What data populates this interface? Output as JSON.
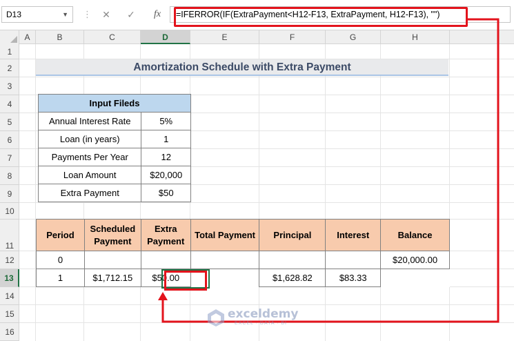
{
  "formula_bar": {
    "name_box": "D13",
    "cancel_icon": "✕",
    "enter_icon": "✓",
    "fx_label": "fx",
    "formula": "=IFERROR(IF(ExtraPayment<H12-F13, ExtraPayment, H12-F13), \"\")"
  },
  "columns": [
    "A",
    "B",
    "C",
    "D",
    "E",
    "F",
    "G",
    "H"
  ],
  "selected_column": "D",
  "rows": [
    "1",
    "2",
    "3",
    "4",
    "5",
    "6",
    "7",
    "8",
    "9",
    "10",
    "11",
    "12",
    "13",
    "14",
    "15",
    "16"
  ],
  "selected_row": "13",
  "title": "Amortization Schedule with Extra Payment",
  "input_table": {
    "header": "Input Fileds",
    "rows": [
      {
        "label": "Annual Interest Rate",
        "value": "5%"
      },
      {
        "label": "Loan (in years)",
        "value": "1"
      },
      {
        "label": "Payments Per Year",
        "value": "12"
      },
      {
        "label": "Loan Amount",
        "value": "$20,000"
      },
      {
        "label": "Extra Payment",
        "value": "$50"
      }
    ]
  },
  "schedule_table": {
    "headers": [
      "Period",
      "Scheduled Payment",
      "Extra Payment",
      "Total Payment",
      "Principal",
      "Interest",
      "Balance"
    ],
    "rows": [
      [
        "0",
        "",
        "",
        "",
        "",
        "",
        "$20,000.00"
      ],
      [
        "1",
        "$1,712.15",
        "$50.00",
        "",
        "$1,628.82",
        "$83.33",
        ""
      ]
    ]
  },
  "watermark": {
    "name": "exceldemy",
    "tagline": "EXCEL · DATA · BI"
  },
  "colors": {
    "highlight": "#e3131c",
    "input_header": "#bdd7ee",
    "schedule_header": "#f8cbad",
    "excel_green": "#217346"
  }
}
